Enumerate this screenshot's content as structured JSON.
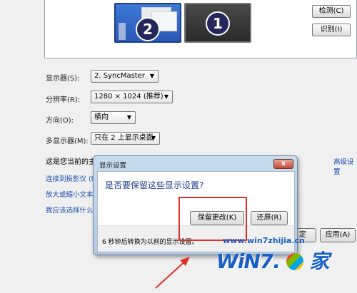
{
  "monitors": {
    "primary_number": "2",
    "secondary_number": "1"
  },
  "actions": {
    "detect": "检测(C)",
    "identify": "识别(I)"
  },
  "form": {
    "display_label": "显示器(S):",
    "display_value": "2. SyncMaster",
    "resolution_label": "分辨率(R):",
    "resolution_value": "1280 × 1024 (推荐)",
    "orientation_label": "方向(O):",
    "orientation_value": "横向",
    "multi_label": "多显示器(M):",
    "multi_value": "只在 2 上显示桌面"
  },
  "background": {
    "current_main_text": "这是您当前的主",
    "advanced_link": "高级设置",
    "link_projector": "连接到投影仪 (t",
    "link_enlarge": "放大或缩小文本",
    "link_choose": "我应该选择什么"
  },
  "dialog": {
    "title": "显示设置",
    "question": "是否要保留这些显示设置?",
    "keep_button": "保留更改(K)",
    "revert_button": "还原(R)",
    "countdown": "6 秒钟后转换为以前的显示设置。",
    "close_glyph": "x"
  },
  "footer": {
    "ok_partial": "定",
    "apply": "应用(A)"
  },
  "watermark": {
    "url": "www.win7zhijia.cn",
    "logo_text": "WiN7.",
    "logo_suffix": "家"
  },
  "colors": {
    "highlight": "#e0312b",
    "link": "#1a4fb3",
    "accent_blue": "#2a58b5"
  }
}
